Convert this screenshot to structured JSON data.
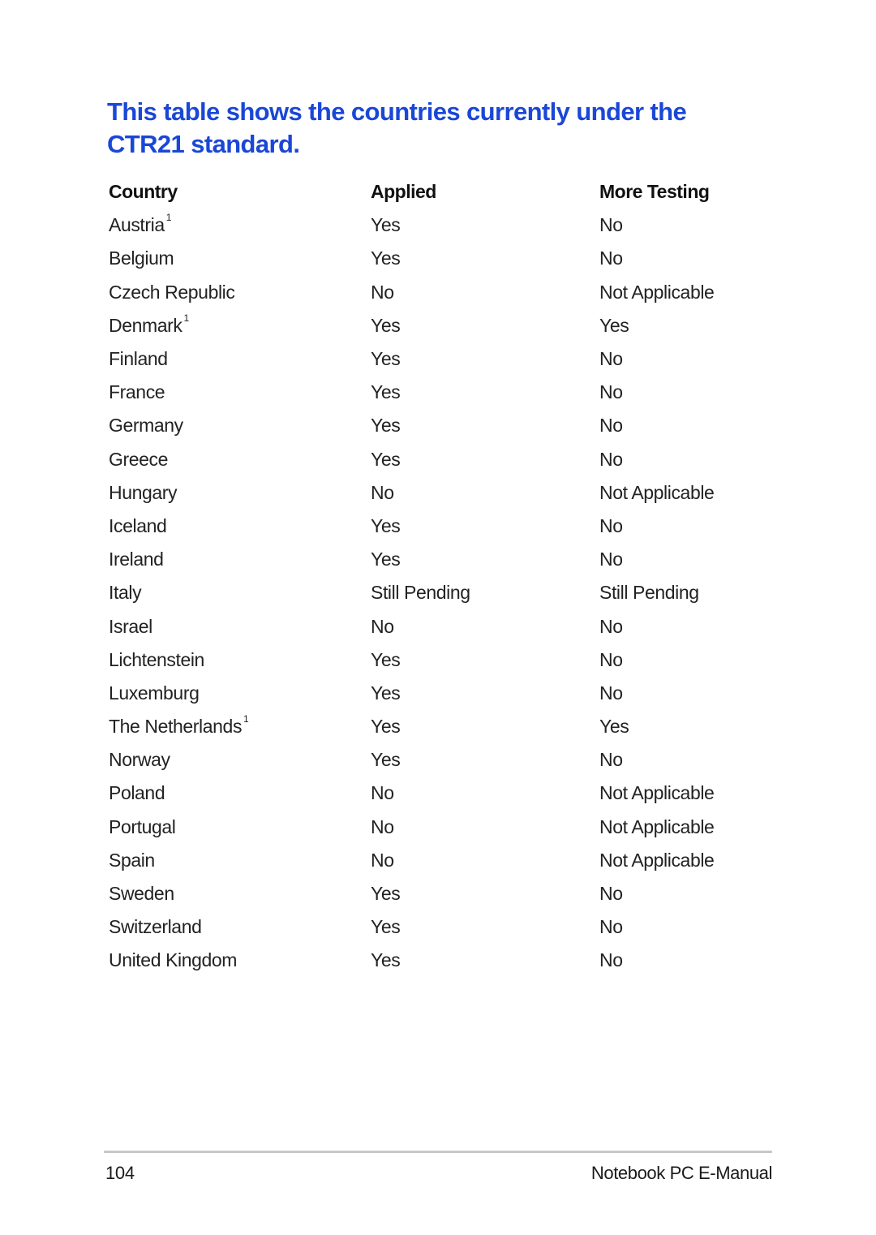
{
  "page": {
    "title": "This table shows the countries currently under the CTR21 standard.",
    "accent_color": "#1a47d6"
  },
  "table": {
    "headers": {
      "country": "Country",
      "applied": "Applied",
      "more_testing": "More Testing"
    },
    "rows": [
      {
        "country": "Austria",
        "footnote": "1",
        "applied": "Yes",
        "more_testing": "No"
      },
      {
        "country": "Belgium",
        "footnote": "",
        "applied": "Yes",
        "more_testing": "No"
      },
      {
        "country": "Czech Republic",
        "footnote": "",
        "applied": "No",
        "more_testing": "Not Applicable"
      },
      {
        "country": "Denmark",
        "footnote": "1",
        "applied": "Yes",
        "more_testing": "Yes"
      },
      {
        "country": "Finland",
        "footnote": "",
        "applied": "Yes",
        "more_testing": "No"
      },
      {
        "country": "France",
        "footnote": "",
        "applied": "Yes",
        "more_testing": "No"
      },
      {
        "country": "Germany",
        "footnote": "",
        "applied": "Yes",
        "more_testing": "No"
      },
      {
        "country": "Greece",
        "footnote": "",
        "applied": "Yes",
        "more_testing": "No"
      },
      {
        "country": "Hungary",
        "footnote": "",
        "applied": "No",
        "more_testing": "Not Applicable"
      },
      {
        "country": "Iceland",
        "footnote": "",
        "applied": "Yes",
        "more_testing": "No"
      },
      {
        "country": "Ireland",
        "footnote": "",
        "applied": "Yes",
        "more_testing": "No"
      },
      {
        "country": "Italy",
        "footnote": "",
        "applied": "Still Pending",
        "more_testing": "Still Pending"
      },
      {
        "country": "Israel",
        "footnote": "",
        "applied": "No",
        "more_testing": "No"
      },
      {
        "country": "Lichtenstein",
        "footnote": "",
        "applied": "Yes",
        "more_testing": "No"
      },
      {
        "country": "Luxemburg",
        "footnote": "",
        "applied": "Yes",
        "more_testing": "No"
      },
      {
        "country": "The Netherlands",
        "footnote": "1",
        "applied": "Yes",
        "more_testing": "Yes"
      },
      {
        "country": "Norway",
        "footnote": "",
        "applied": "Yes",
        "more_testing": "No"
      },
      {
        "country": "Poland",
        "footnote": "",
        "applied": "No",
        "more_testing": "Not Applicable"
      },
      {
        "country": "Portugal",
        "footnote": "",
        "applied": "No",
        "more_testing": "Not Applicable"
      },
      {
        "country": "Spain",
        "footnote": "",
        "applied": "No",
        "more_testing": "Not Applicable"
      },
      {
        "country": "Sweden",
        "footnote": "",
        "applied": "Yes",
        "more_testing": "No"
      },
      {
        "country": "Switzerland",
        "footnote": "",
        "applied": "Yes",
        "more_testing": "No"
      },
      {
        "country": "United Kingdom",
        "footnote": "",
        "applied": "Yes",
        "more_testing": "No"
      }
    ]
  },
  "footer": {
    "page_number": "104",
    "manual_name": "Notebook PC E-Manual"
  }
}
